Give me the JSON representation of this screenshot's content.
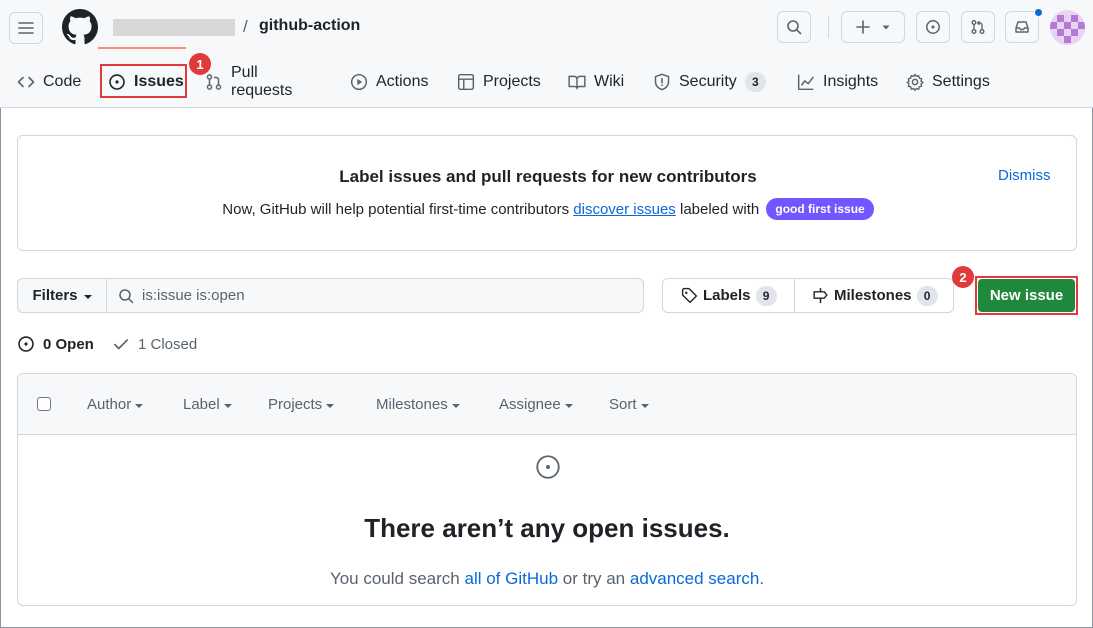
{
  "header": {
    "repo_name": "github-action",
    "separator": "/"
  },
  "nav": {
    "tabs": [
      {
        "label": "Code",
        "icon": "code-icon"
      },
      {
        "label": "Issues",
        "icon": "issue-opened-icon"
      },
      {
        "label": "Pull requests",
        "icon": "git-pull-request-icon"
      },
      {
        "label": "Actions",
        "icon": "play-icon"
      },
      {
        "label": "Projects",
        "icon": "table-icon"
      },
      {
        "label": "Wiki",
        "icon": "book-icon"
      },
      {
        "label": "Security",
        "icon": "shield-icon",
        "counter": "3"
      },
      {
        "label": "Insights",
        "icon": "graph-icon"
      },
      {
        "label": "Settings",
        "icon": "gear-icon"
      }
    ],
    "selected": "Issues"
  },
  "annotations": {
    "marker_1": "1",
    "marker_2": "2"
  },
  "banner": {
    "title": "Label issues and pull requests for new contributors",
    "body_prefix": "Now, GitHub will help potential first-time contributors",
    "link": "discover issues",
    "body_suffix": "labeled with",
    "label_badge": "good first issue",
    "dismiss": "Dismiss"
  },
  "filters": {
    "button": "Filters",
    "query": "is:issue is:open"
  },
  "labels": {
    "label": "Labels",
    "count": "9"
  },
  "milestones": {
    "label": "Milestones",
    "count": "0"
  },
  "new_issue": "New issue",
  "states": {
    "open": "0 Open",
    "closed": "1 Closed"
  },
  "columns": [
    "Author",
    "Label",
    "Projects",
    "Milestones",
    "Assignee",
    "Sort"
  ],
  "blankslate": {
    "title": "There aren’t any open issues.",
    "text_prefix": "You could search",
    "link1": "all of GitHub",
    "text_mid": "or try an",
    "link2": "advanced search."
  },
  "colors": {
    "accent": "#0969da",
    "primary_button": "#1f883d",
    "selected_underline": "#fd8c73",
    "annotation": "#e03a3a",
    "good_first_issue": "#7057ff"
  }
}
